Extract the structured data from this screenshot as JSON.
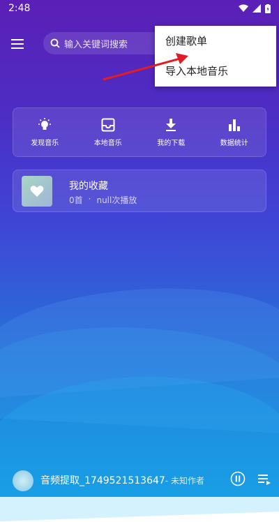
{
  "status": {
    "time": "2:48"
  },
  "search": {
    "placeholder": "输入关键词搜索"
  },
  "popup_menu": {
    "items": [
      "创建歌单",
      "导入本地音乐"
    ]
  },
  "quick_actions": [
    {
      "label": "发现音乐",
      "icon": "bulb-icon"
    },
    {
      "label": "本地音乐",
      "icon": "inbox-icon"
    },
    {
      "label": "我的下载",
      "icon": "download-icon"
    },
    {
      "label": "数据统计",
      "icon": "bar-chart-icon"
    }
  ],
  "favorites": {
    "title": "我的收藏",
    "count": "0首",
    "separator": "·",
    "plays": "null次播放"
  },
  "player": {
    "song": "音频提取_1749521513647",
    "artist": "- 未知作者"
  },
  "colors": {
    "accent_arrow": "#e01d26",
    "background_top": "#5b1fb6",
    "background_bottom": "#1597e2"
  }
}
